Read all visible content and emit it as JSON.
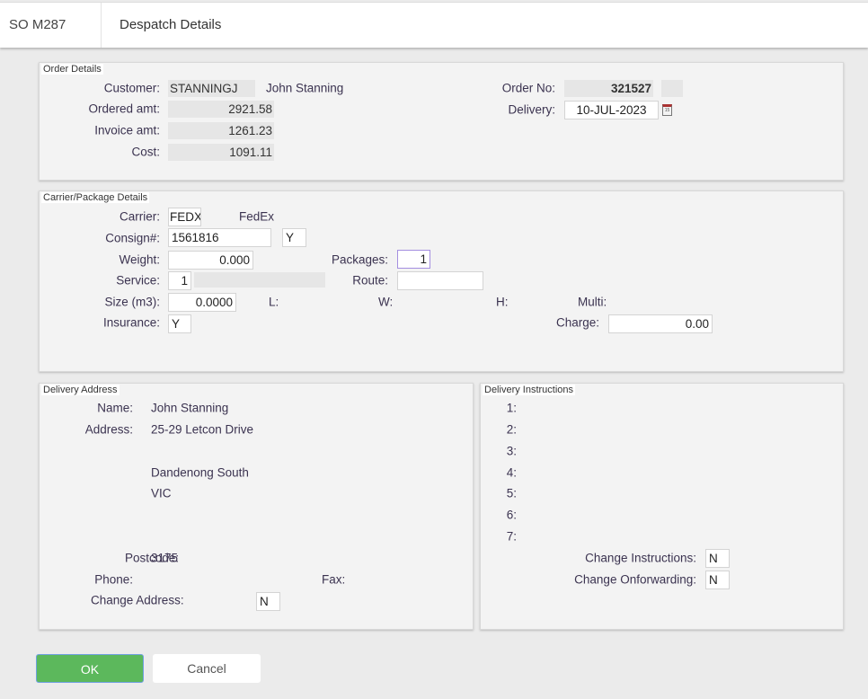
{
  "header": {
    "code": "SO M287",
    "title": "Despatch Details"
  },
  "order": {
    "legend": "Order Details",
    "customer_label": "Customer:",
    "customer_code": "STANNINGJ",
    "customer_name": "John Stanning",
    "ordered_label": "Ordered amt:",
    "ordered": "2921.58",
    "invoice_label": "Invoice amt:",
    "invoice": "1261.23",
    "cost_label": "Cost:",
    "cost": "1091.11",
    "order_no_label": "Order No:",
    "order_no": "321527",
    "delivery_label": "Delivery:",
    "delivery": "10-JUL-2023"
  },
  "carrier": {
    "legend": "Carrier/Package Details",
    "carrier_label": "Carrier:",
    "carrier": "FEDX",
    "carrier_name": "FedEx",
    "consign_label": "Consign#:",
    "consign": "1561816",
    "consign_flag": "Y",
    "weight_label": "Weight:",
    "weight": "0.000",
    "packages_label": "Packages:",
    "packages": "1",
    "service_label": "Service:",
    "service": "1",
    "route_label": "Route:",
    "route": "",
    "size_label": "Size (m3):",
    "size": "0.0000",
    "l_label": "L:",
    "w_label": "W:",
    "h_label": "H:",
    "multi_label": "Multi:",
    "insurance_label": "Insurance:",
    "insurance": "Y",
    "charge_label": "Charge:",
    "charge": "0.00"
  },
  "address": {
    "legend": "Delivery Address",
    "name_label": "Name:",
    "name": "John Stanning",
    "address_label": "Address:",
    "line1": "25-29 Letcon Drive",
    "line3": "Dandenong South",
    "line4": "VIC",
    "postcode_label": "Postcode:",
    "postcode": "3175",
    "phone_label": "Phone:",
    "fax_label": "Fax:",
    "change_label": "Change Address:",
    "change": "N"
  },
  "instructions": {
    "legend": "Delivery Instructions",
    "lines": [
      "1:",
      "2:",
      "3:",
      "4:",
      "5:",
      "6:",
      "7:"
    ],
    "change_instr_label": "Change Instructions:",
    "change_instr": "N",
    "change_onf_label": "Change Onforwarding:",
    "change_onf": "N"
  },
  "buttons": {
    "ok": "OK",
    "cancel": "Cancel"
  },
  "colors": {
    "ok": "#5cb85c"
  }
}
